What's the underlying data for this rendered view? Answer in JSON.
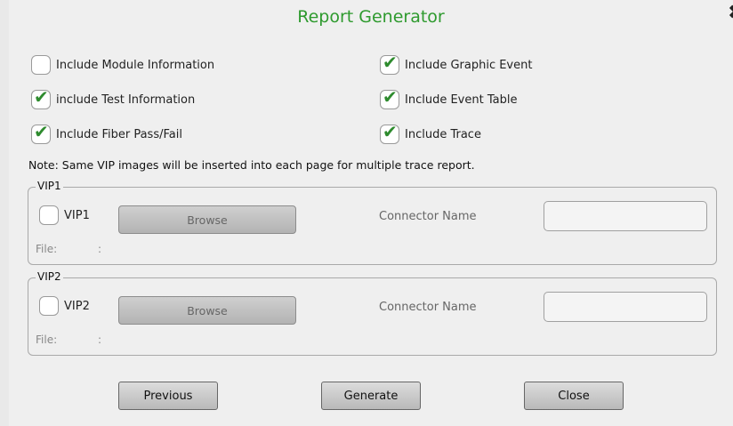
{
  "dialog": {
    "title": "Report Generator",
    "close_glyph": "✖"
  },
  "options": [
    {
      "label": "Include Module Information",
      "checked": false
    },
    {
      "label": "Include Graphic Event",
      "checked": true
    },
    {
      "label": "include Test Information",
      "checked": true
    },
    {
      "label": "Include Event Table",
      "checked": true
    },
    {
      "label": "Include Fiber Pass/Fail",
      "checked": true
    },
    {
      "label": "Include Trace",
      "checked": true
    }
  ],
  "note": "Note: Same VIP images will be inserted into each page for multiple trace report.",
  "vip1": {
    "group_label": "VIP1",
    "checkbox_label": "VIP1",
    "checked": false,
    "browse_label": "Browse",
    "connector_label": "Connector Name",
    "connector_value": "",
    "file_label": "File:",
    "file_sep": ":"
  },
  "vip2": {
    "group_label": "VIP2",
    "checkbox_label": "VIP2",
    "checked": false,
    "browse_label": "Browse",
    "connector_label": "Connector Name",
    "connector_value": "",
    "file_label": "File:",
    "file_sep": ":"
  },
  "buttons": {
    "previous": "Previous",
    "generate": "Generate",
    "close": "Close"
  },
  "colors": {
    "title": "#2e9a2e",
    "check": "#2e8b2e"
  }
}
